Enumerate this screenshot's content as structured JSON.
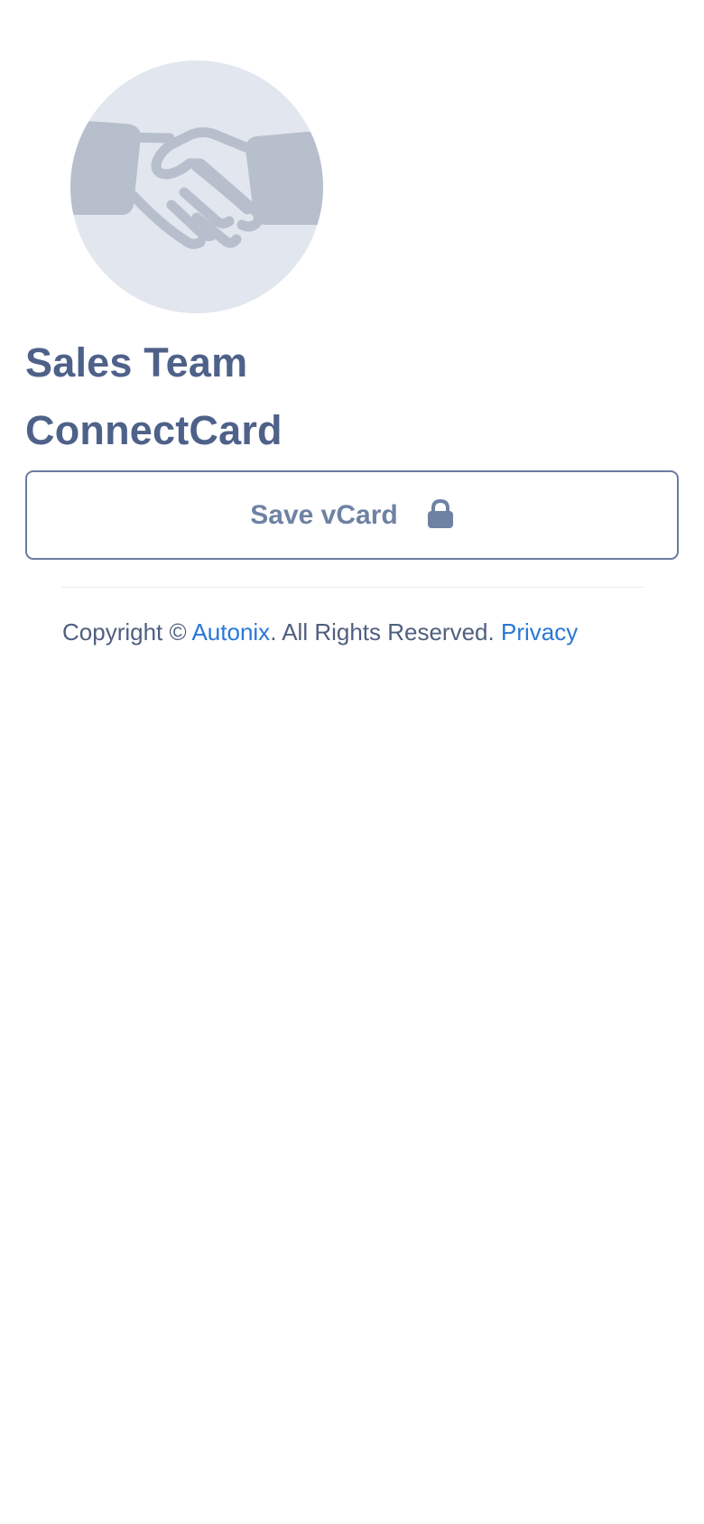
{
  "profile": {
    "avatar_icon": "handshake-icon",
    "title_line1": "Sales Team",
    "title_line2": "ConnectCard"
  },
  "actions": {
    "save_label": "Save vCard",
    "save_icon": "lock-icon"
  },
  "footer": {
    "copyright_prefix": "Copyright ©",
    "company_link": "Autonix",
    "rights_text": ". All Rights Reserved.",
    "privacy_link": "Privacy"
  },
  "colors": {
    "title": "#4e6189",
    "button_border": "#6a7ca0",
    "button_text": "#6e82a3",
    "link": "#2a78d6",
    "avatar_bg": "#e2e6ee",
    "avatar_icon": "#b7bfcc"
  }
}
